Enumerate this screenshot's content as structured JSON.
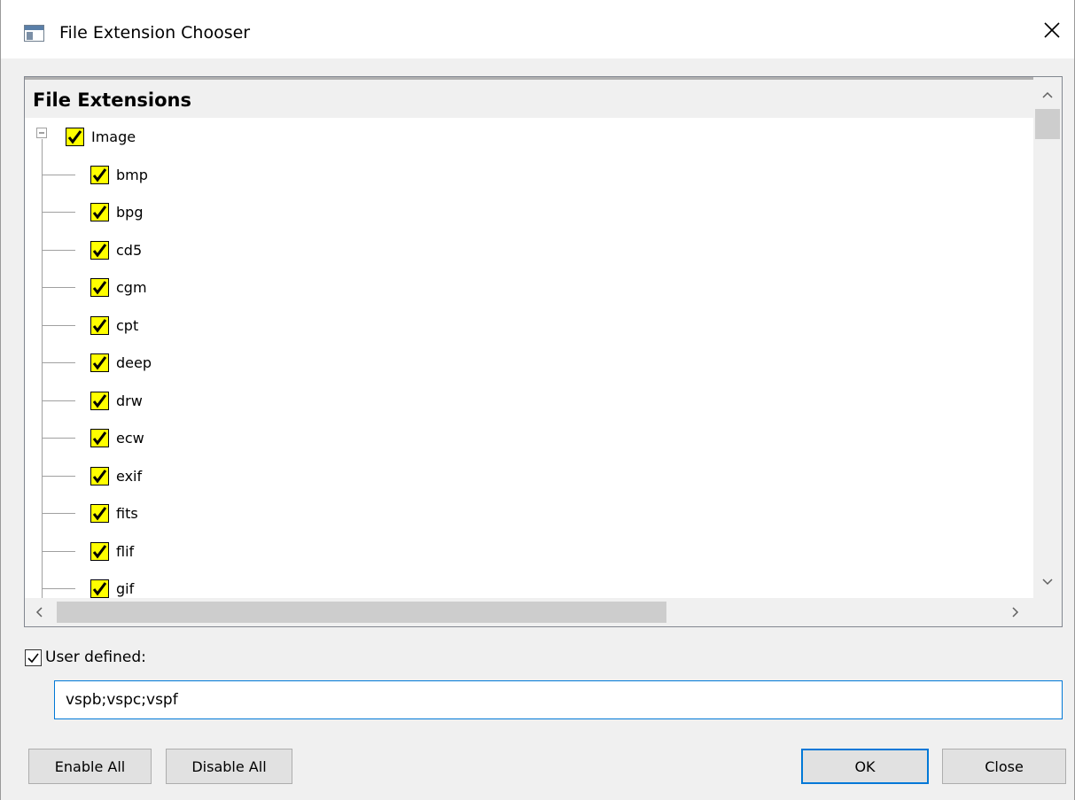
{
  "window": {
    "title": "File Extension Chooser",
    "close_glyph": "✕"
  },
  "tree": {
    "header": "File Extensions",
    "root": {
      "label": "Image",
      "checked": true
    },
    "items": [
      {
        "label": "bmp",
        "checked": true
      },
      {
        "label": "bpg",
        "checked": true
      },
      {
        "label": "cd5",
        "checked": true
      },
      {
        "label": "cgm",
        "checked": true
      },
      {
        "label": "cpt",
        "checked": true
      },
      {
        "label": "deep",
        "checked": true
      },
      {
        "label": "drw",
        "checked": true
      },
      {
        "label": "ecw",
        "checked": true
      },
      {
        "label": "exif",
        "checked": true
      },
      {
        "label": "fits",
        "checked": true
      },
      {
        "label": "flif",
        "checked": true
      },
      {
        "label": "gif",
        "checked": true
      }
    ],
    "check_color": "#ffff00"
  },
  "user_defined": {
    "label": "User defined:",
    "checked": true,
    "value": "vspb;vspc;vspf"
  },
  "buttons": {
    "enable_all": "Enable All",
    "disable_all": "Disable All",
    "ok": "OK",
    "close": "Close"
  },
  "colors": {
    "focus_border": "#0078d7"
  }
}
